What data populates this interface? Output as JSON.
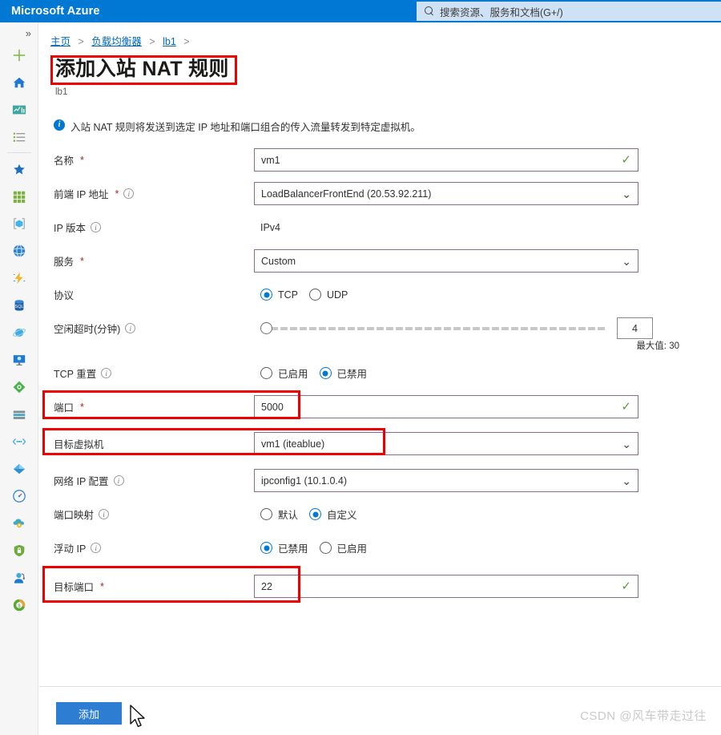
{
  "topbar": {
    "brand": "Microsoft Azure",
    "search_placeholder": "搜索资源、服务和文档(G+/)",
    "search_icon": "search-icon",
    "brand_color": "#0078d4"
  },
  "rail": {
    "collapse_glyph": "»",
    "items": [
      {
        "name": "create-resource",
        "icon": "plus-icon",
        "color": "#7cb342"
      },
      {
        "name": "home",
        "icon": "home-icon",
        "color": "#1e7ad1"
      },
      {
        "name": "dashboard",
        "icon": "dashboard-icon",
        "color": "#3ca7a0"
      },
      {
        "name": "all-services",
        "icon": "list-icon",
        "color": "#7a7a7a"
      },
      {
        "name": "favorites",
        "icon": "star-icon",
        "color": "#1e6fbf"
      },
      {
        "name": "all-resources",
        "icon": "grid-icon",
        "color": "#7cb342"
      },
      {
        "name": "resource-groups",
        "icon": "cube-icon",
        "color": "#40b5e8"
      },
      {
        "name": "app-services",
        "icon": "globe-icon",
        "color": "#2f80c9"
      },
      {
        "name": "function-app",
        "icon": "lightning-icon",
        "color": "#f0b429"
      },
      {
        "name": "sql-databases",
        "icon": "sql-database-icon",
        "color": "#1f5fa8"
      },
      {
        "name": "azure-cosmos-db",
        "icon": "planet-icon",
        "color": "#3fa9e0"
      },
      {
        "name": "virtual-machines",
        "icon": "monitor-icon",
        "color": "#1e7ad1"
      },
      {
        "name": "load-balancers",
        "icon": "diamond-node-icon",
        "color": "#4caf50"
      },
      {
        "name": "storage-accounts",
        "icon": "stack-icon",
        "color": "#3fa9c2"
      },
      {
        "name": "virtual-networks",
        "icon": "network-icon",
        "color": "#3fa9e0"
      },
      {
        "name": "azure-active-directory",
        "icon": "diamond-icon",
        "color": "#3fa9e0"
      },
      {
        "name": "monitor",
        "icon": "gauge-icon",
        "color": "#2f80c9"
      },
      {
        "name": "advisor",
        "icon": "cloud-gear-icon",
        "color": "#3fa9c2"
      },
      {
        "name": "security-center",
        "icon": "shield-icon",
        "color": "#6faa3d"
      },
      {
        "name": "help-and-support",
        "icon": "headset-user-icon",
        "color": "#1e7ad1"
      },
      {
        "name": "cost-management",
        "icon": "cost-icon",
        "color": "#5aa832"
      }
    ]
  },
  "breadcrumb": {
    "items": [
      "主页",
      "负载均衡器",
      "lb1"
    ],
    "separator": ">"
  },
  "page": {
    "title": "添加入站 NAT 规则",
    "subtitle": "lb1",
    "info_icon": "info-icon",
    "info_text": "入站 NAT 规则将发送到选定 IP 地址和端口组合的传入流量转发到特定虚拟机。"
  },
  "form": {
    "name": {
      "label": "名称",
      "required": "*",
      "value": "vm1",
      "valid_icon": "check-icon"
    },
    "frontend_ip": {
      "label": "前端 IP 地址",
      "required": "*",
      "info_icon": "info-circle-icon",
      "value": "LoadBalancerFrontEnd (20.53.92.211)",
      "chevron": "chevron-down-icon"
    },
    "ip_version": {
      "label": "IP 版本",
      "info_icon": "info-circle-icon",
      "value": "IPv4"
    },
    "service": {
      "label": "服务",
      "required": "*",
      "value": "Custom",
      "chevron": "chevron-down-icon"
    },
    "protocol": {
      "label": "协议",
      "options": [
        "TCP",
        "UDP"
      ],
      "selected": "TCP"
    },
    "idle_timeout": {
      "label": "空闲超时(分钟)",
      "info_icon": "info-circle-icon",
      "value": "4",
      "max_label": "最大值: 30",
      "min": 4,
      "max": 30
    },
    "tcp_reset": {
      "label": "TCP 重置",
      "info_icon": "info-circle-icon",
      "options": [
        "已启用",
        "已禁用"
      ],
      "selected": "已禁用"
    },
    "port": {
      "label": "端口",
      "required": "*",
      "value": "5000",
      "valid_icon": "check-icon",
      "highlighted": true
    },
    "target_vm": {
      "label": "目标虚拟机",
      "value": "vm1 (iteablue)",
      "chevron": "chevron-down-icon",
      "highlighted": true
    },
    "network_ip_config": {
      "label": "网络 IP 配置",
      "info_icon": "info-circle-icon",
      "value": "ipconfig1 (10.1.0.4)",
      "chevron": "chevron-down-icon"
    },
    "port_mapping": {
      "label": "端口映射",
      "info_icon": "info-circle-icon",
      "options": [
        "默认",
        "自定义"
      ],
      "selected": "自定义"
    },
    "floating_ip": {
      "label": "浮动 IP",
      "info_icon": "info-circle-icon",
      "options": [
        "已禁用",
        "已启用"
      ],
      "selected": "已禁用"
    },
    "target_port": {
      "label": "目标端口",
      "required": "*",
      "value": "22",
      "valid_icon": "check-icon",
      "highlighted": true
    }
  },
  "footer": {
    "add_label": "添加",
    "add_color": "#2d7dd2"
  },
  "watermark": "CSDN @风车带走过往",
  "annotation": {
    "color": "#ee0000"
  }
}
